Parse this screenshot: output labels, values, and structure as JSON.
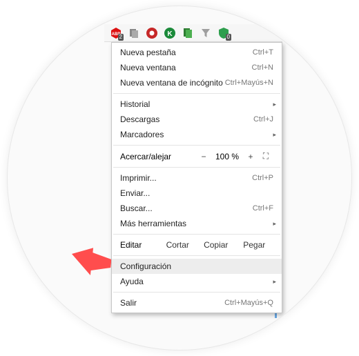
{
  "toolbar": {
    "extensions": [
      {
        "name": "adblock",
        "badge": "2",
        "bg": "#d11",
        "fg": "#fff",
        "glyph": "ABP"
      },
      {
        "name": "copy",
        "badge": "",
        "bg": "#888",
        "fg": "#fff",
        "glyph": "❐"
      },
      {
        "name": "oblock",
        "badge": "",
        "bg": "#c62828",
        "fg": "#fff",
        "glyph": "O"
      },
      {
        "name": "kaspersky",
        "badge": "",
        "bg": "#1b8a3a",
        "fg": "#fff",
        "glyph": "K"
      },
      {
        "name": "docs",
        "badge": "",
        "bg": "#2e7d32",
        "fg": "#fff",
        "glyph": "❐"
      },
      {
        "name": "filter",
        "badge": "",
        "bg": "#9e9e9e",
        "fg": "#fff",
        "glyph": "Y"
      },
      {
        "name": "shield",
        "badge": "0",
        "bg": "#2e9e4d",
        "fg": "#fff",
        "glyph": "◆"
      }
    ]
  },
  "menu": {
    "new_tab": {
      "label": "Nueva pestaña",
      "shortcut": "Ctrl+T"
    },
    "new_window": {
      "label": "Nueva ventana",
      "shortcut": "Ctrl+N"
    },
    "incognito": {
      "label": "Nueva ventana de incógnito",
      "shortcut": "Ctrl+Mayús+N"
    },
    "history": {
      "label": "Historial"
    },
    "downloads": {
      "label": "Descargas",
      "shortcut": "Ctrl+J"
    },
    "bookmarks": {
      "label": "Marcadores"
    },
    "zoom": {
      "label": "Acercar/alejar",
      "minus": "−",
      "value": "100 %",
      "plus": "+"
    },
    "print": {
      "label": "Imprimir...",
      "shortcut": "Ctrl+P"
    },
    "cast": {
      "label": "Enviar..."
    },
    "find": {
      "label": "Buscar...",
      "shortcut": "Ctrl+F"
    },
    "more_tools": {
      "label": "Más herramientas"
    },
    "edit": {
      "label": "Editar",
      "cut": "Cortar",
      "copy": "Copiar",
      "paste": "Pegar"
    },
    "settings": {
      "label": "Configuración"
    },
    "help": {
      "label": "Ayuda"
    },
    "exit": {
      "label": "Salir",
      "shortcut": "Ctrl+Mayús+Q"
    }
  }
}
